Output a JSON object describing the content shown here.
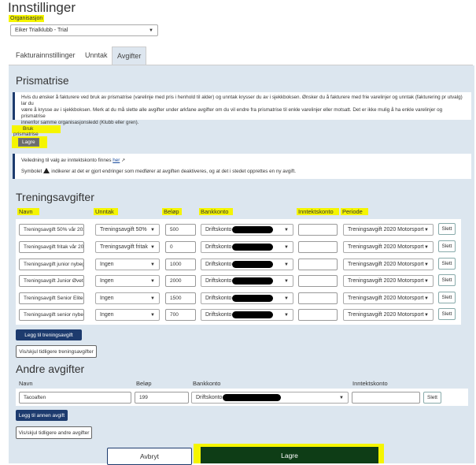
{
  "title": "Innstillinger",
  "organisation": {
    "label": "Organisasjon",
    "value": "Eiker Trialklubb - Trial"
  },
  "tabs": [
    "Fakturainnstillinger",
    "Unntak",
    "Avgifter"
  ],
  "prismatrise": {
    "heading": "Prismatrise",
    "info_line1": "Hvis du ønsker å fakturere ved bruk av prismatrise (varelinje med pris i henhold til alder) og unntak krysser du av i sjekkboksen. Ønsker du å fakturere med frie varelinjer og unntak (fakturering pr utvalg) lar du",
    "info_line2": "være å krysse av i sjekkboksen. Merk at du må slette alle avgifter under arkfane avgifter om du vil endre fra prismatrise til enkle varelinjer eller motsatt. Det er ikke mulig å ha enkle varelinjer og prismatrise",
    "info_line3": "innenfor samme organisasjonsledd (Klubb eller gren).",
    "checkbox_label": "Bruk prismatrise",
    "save_label": "Lagre"
  },
  "guide": {
    "line1_prefix": "Veiledning til valg av inntektskonto finnes",
    "line1_link": "her",
    "line2_prefix": "Symbolet",
    "line2_suffix": "indikerer at det er gjort endringer som medfører at avgiften deaktiveres, og at det i stedet opprettes en ny avgift."
  },
  "treningsavgifter": {
    "heading": "Treningsavgifter",
    "columns": [
      "Navn",
      "Unntak",
      "Beløp",
      "Bankkonto",
      "Inntektskonto",
      "Periode"
    ],
    "rows": [
      {
        "navn": "Treningsavgift 50% vår 202",
        "unntak": "Treningsavgift 50%",
        "belop": "500",
        "bankkonto": "Driftskonto",
        "inntektskonto": "",
        "periode": "Treningsavgift 2020 Motorsport",
        "slett": "Slett"
      },
      {
        "navn": "Treningsavgift fritak vår 20",
        "unntak": "Treningsavgift fritak",
        "belop": "0",
        "bankkonto": "Driftskonto",
        "inntektskonto": "",
        "periode": "Treningsavgift 2020 Motorsport",
        "slett": "Slett"
      },
      {
        "navn": "Treningsavgift junior nybeg",
        "unntak": "Ingen",
        "belop": "1000",
        "bankkonto": "Driftskonto",
        "inntektskonto": "",
        "periode": "Treningsavgift 2020 Motorsport",
        "slett": "Slett"
      },
      {
        "navn": "Treningsavgift Junior Øvet",
        "unntak": "Ingen",
        "belop": "2000",
        "bankkonto": "Driftskonto",
        "inntektskonto": "",
        "periode": "Treningsavgift 2020 Motorsport",
        "slett": "Slett"
      },
      {
        "navn": "Treningsavgift Senior Elite",
        "unntak": "Ingen",
        "belop": "1500",
        "bankkonto": "Driftskonto",
        "inntektskonto": "",
        "periode": "Treningsavgift 2020 Motorsport",
        "slett": "Slett"
      },
      {
        "navn": "Treningsavgift senior nybeg",
        "unntak": "Ingen",
        "belop": "700",
        "bankkonto": "Driftskonto",
        "inntektskonto": "",
        "periode": "Treningsavgift 2020 Motorsport",
        "slett": "Slett"
      }
    ],
    "add_label": "Legg til treningsavgift",
    "toggle_label": "Vis/skjul tidligere treningsavgifter"
  },
  "andre": {
    "heading": "Andre avgifter",
    "columns": [
      "Navn",
      "Beløp",
      "Bankkonto",
      "Inntektskonto"
    ],
    "row": {
      "navn": "Tacoaften",
      "belop": "199",
      "bankkonto": "Driftskonto",
      "inntektskonto": "",
      "slett": "Slett"
    },
    "add_label": "Legg til annen avgift",
    "toggle_label": "Vis/skjul tidligere andre avgifter"
  },
  "footer": {
    "cancel_label": "Avbryt",
    "save_label": "Lagre"
  },
  "colors": {
    "navy": "#1d3b6e",
    "highlight": "#f5f500",
    "panel": "#dce6ef",
    "footer_save": "#0e3d16"
  }
}
